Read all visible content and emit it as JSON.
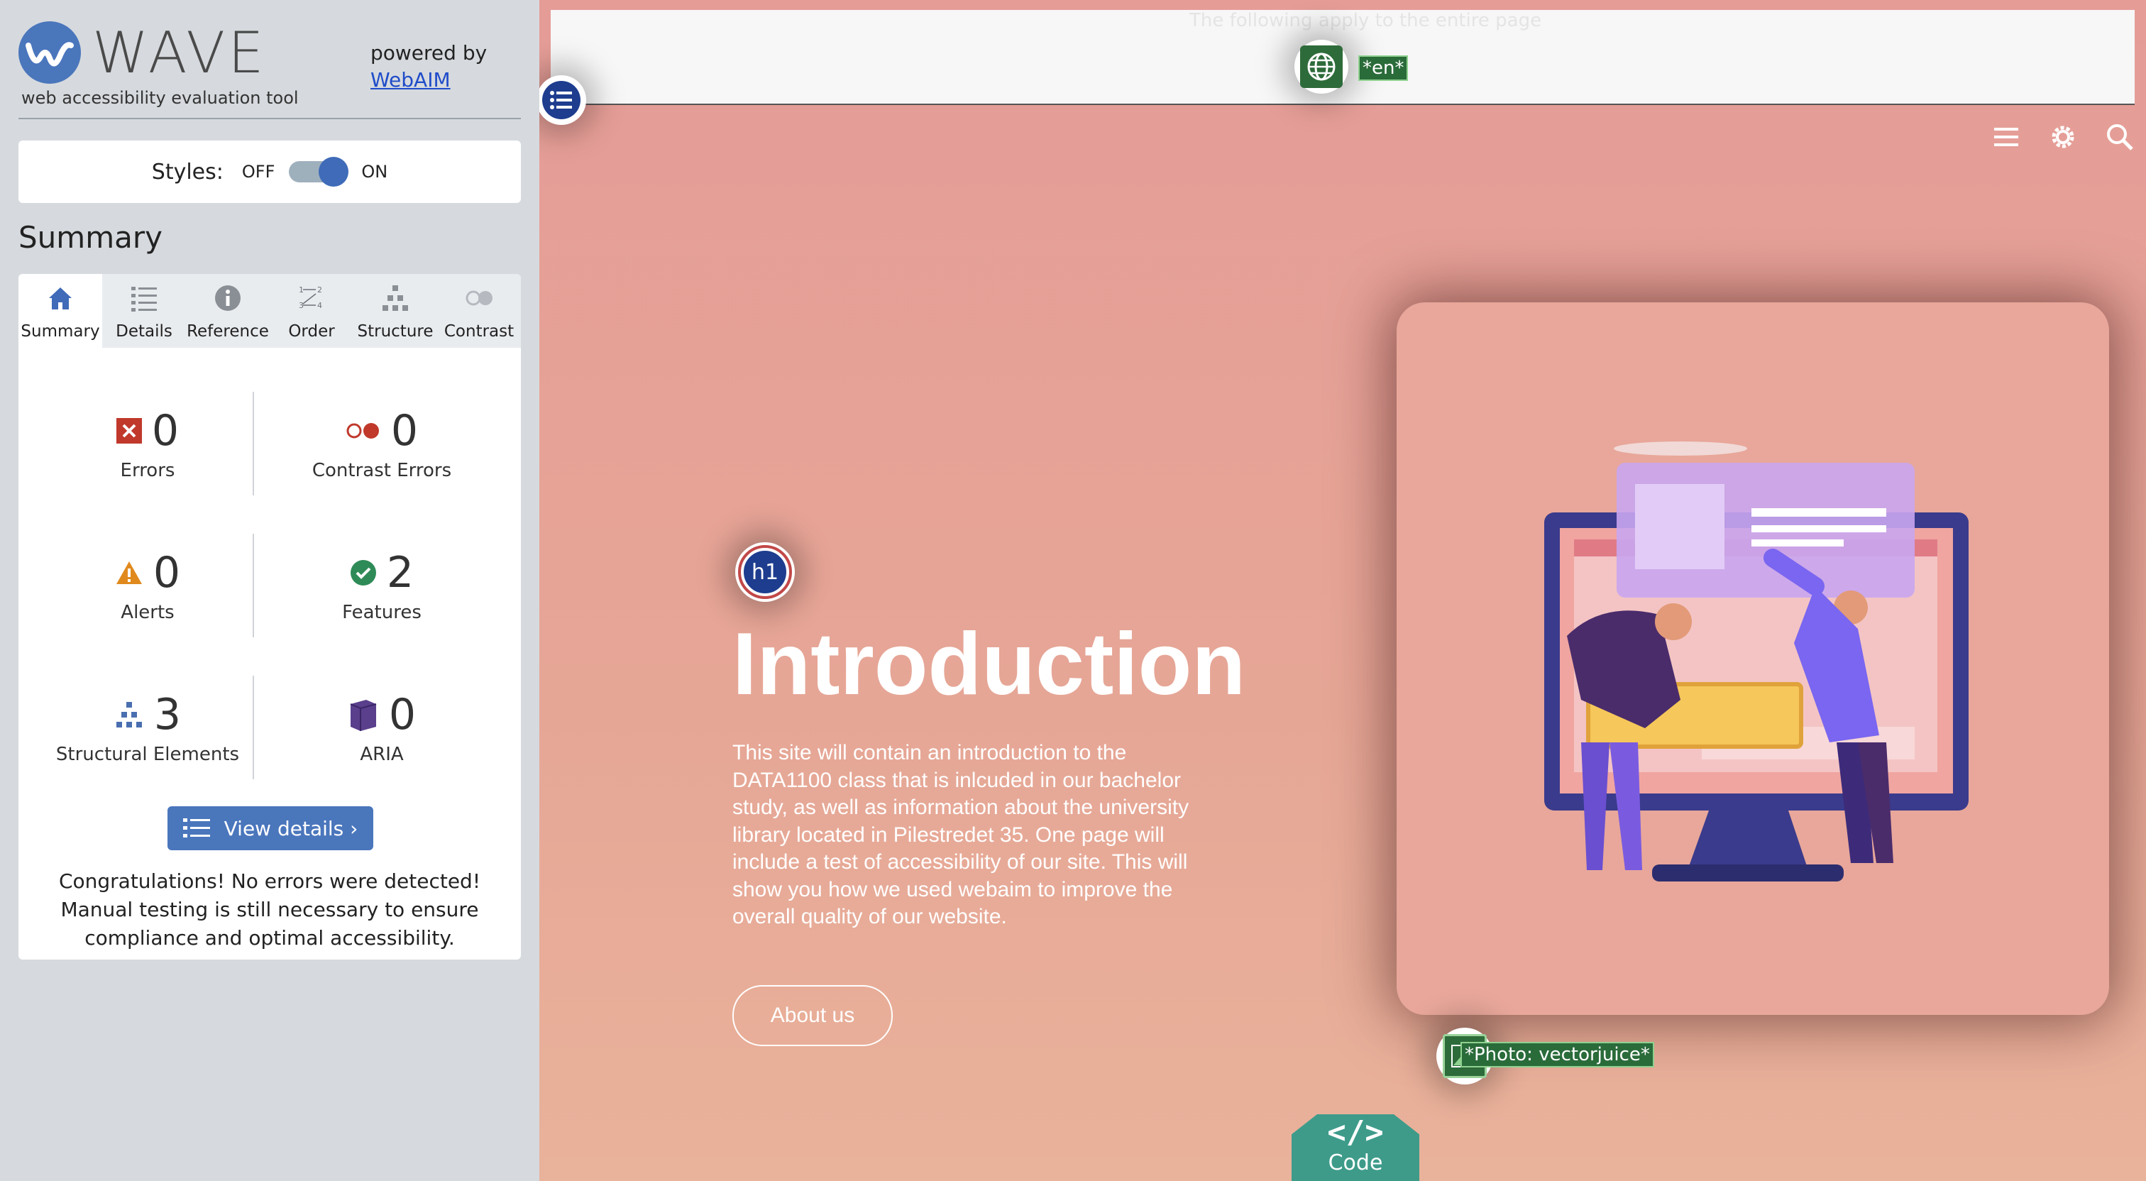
{
  "sidebar": {
    "logo_word": "WAVE",
    "logo_tagline": "web accessibility evaluation tool",
    "powered_by": "powered by",
    "powered_by_link": "WebAIM",
    "styles_label": "Styles:",
    "styles_off": "OFF",
    "styles_on": "ON",
    "summary_heading": "Summary",
    "tabs": [
      {
        "label": "Summary",
        "icon": "home-icon"
      },
      {
        "label": "Details",
        "icon": "list-icon"
      },
      {
        "label": "Reference",
        "icon": "info-icon"
      },
      {
        "label": "Order",
        "icon": "order-icon"
      },
      {
        "label": "Structure",
        "icon": "structure-icon"
      },
      {
        "label": "Contrast",
        "icon": "contrast-icon"
      }
    ],
    "stats": [
      {
        "label": "Errors",
        "value": "0",
        "icon": "error-icon"
      },
      {
        "label": "Contrast Errors",
        "value": "0",
        "icon": "contrast-error-icon"
      },
      {
        "label": "Alerts",
        "value": "0",
        "icon": "alert-icon"
      },
      {
        "label": "Features",
        "value": "2",
        "icon": "feature-icon"
      },
      {
        "label": "Structural Elements",
        "value": "3",
        "icon": "structure-icon"
      },
      {
        "label": "ARIA",
        "value": "0",
        "icon": "aria-icon"
      }
    ],
    "view_details": "View details ›",
    "congrats": "Congratulations! No errors were detected! Manual testing is still necessary to ensure compliance and optimal accessibility."
  },
  "page": {
    "top_strip_text": "The following apply to the entire page",
    "lang_tag": "*en*",
    "h1_badge": "h1",
    "hero_title": "Introduction",
    "hero_text": "This site will contain an introduction to the DATA1100 class that is inlcuded in our bachelor study, as well as information about the university library located in Pilestredet 35. One page will include a test of accessibility of our site. This will show you how we used webaim to improve the overall quality of our website.",
    "about_button": "About us",
    "image_tag": "*Photo: vectorjuice*",
    "code_glyph": "</>",
    "code_label": "Code"
  },
  "colors": {
    "wave_blue": "#4a76bc",
    "error_red": "#c0392b",
    "feature_green": "#2e8b57",
    "alert_orange": "#e08a1e",
    "aria_purple": "#5a3f8c",
    "code_teal": "#3e9b8a"
  }
}
